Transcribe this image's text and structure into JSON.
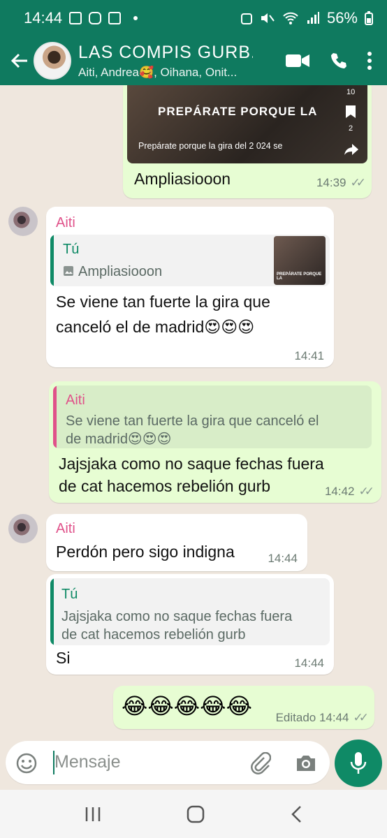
{
  "status": {
    "time": "14:44",
    "battery": "56%"
  },
  "header": {
    "title": "LAS  COMPIS GURB...",
    "subtitle": "Aiti, Andrea🥰, Oihana, Onit..."
  },
  "messages": {
    "m1": {
      "video_caption_big": "PREPÁRATE PORQUE LA",
      "video_caption_small": "Prepárate porque la gira del 2 024 se",
      "side_counts": [
        "10",
        "2"
      ],
      "text": "Ampliasiooon",
      "time": "14:39"
    },
    "m2": {
      "sender": "Aiti",
      "quote_author": "Tú",
      "quote_text": "Ampliasiooon",
      "thumb_caption": "PREPÁRATE PORQUE LA",
      "text_line1": "Se viene tan fuerte la gira que",
      "text_line2": "canceló el de madrid😍😍😍",
      "time": "14:41"
    },
    "m3": {
      "quote_author": "Aiti",
      "quote_line1": "Se viene tan fuerte la gira que canceló el",
      "quote_line2": "de madrid😍😍😍",
      "text_line1": "Jajsjaka como no saque fechas fuera",
      "text_line2": "de cat hacemos rebelión gurb",
      "time": "14:42"
    },
    "m4": {
      "sender": "Aiti",
      "text": "Perdón pero sigo indigna",
      "time": "14:44"
    },
    "m5": {
      "quote_author": "Tú",
      "quote_line1": "Jajsjaka como no saque fechas fuera",
      "quote_line2": "de cat hacemos rebelión gurb",
      "text": "Si",
      "time": "14:44"
    },
    "m6": {
      "text": "😂😂😂😂😂",
      "time": "Editado 14:44"
    }
  },
  "input": {
    "placeholder": "Mensaje"
  },
  "colors": {
    "header": "#0f7a5f",
    "outgoing": "#e7fdd3",
    "incoming": "#ffffff",
    "accent": "#0f8a66",
    "sender": "#e0528a"
  }
}
